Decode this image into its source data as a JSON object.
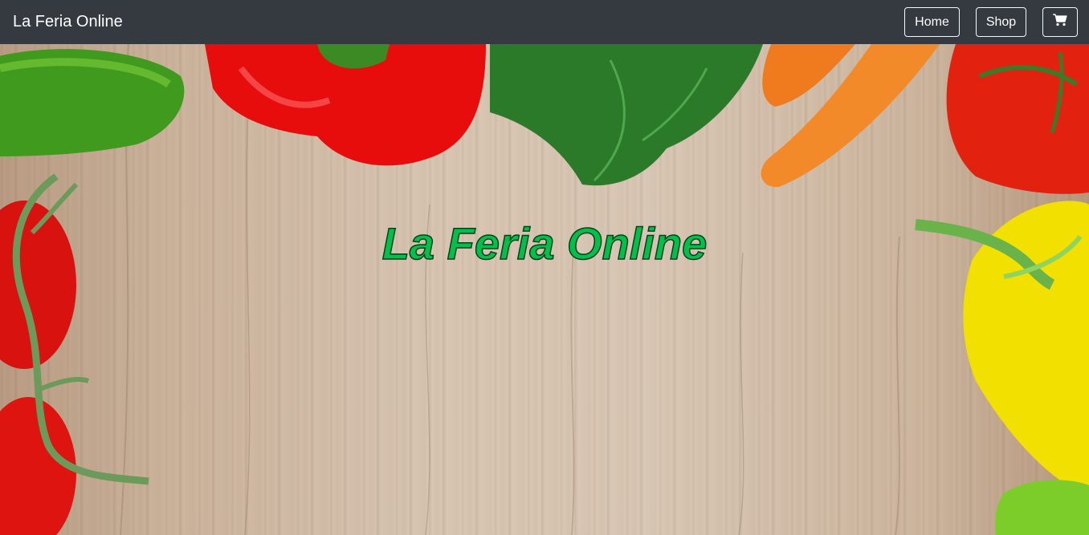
{
  "navbar": {
    "brand": "La Feria Online",
    "home_label": "Home",
    "shop_label": "Shop",
    "cart_icon": "shopping-cart-icon"
  },
  "hero": {
    "title": "La Feria Online",
    "background": "wooden table with vegetables",
    "title_color": "#00c04b"
  },
  "colors": {
    "navbar_bg": "#343a40",
    "nav_text": "#ffffff"
  }
}
